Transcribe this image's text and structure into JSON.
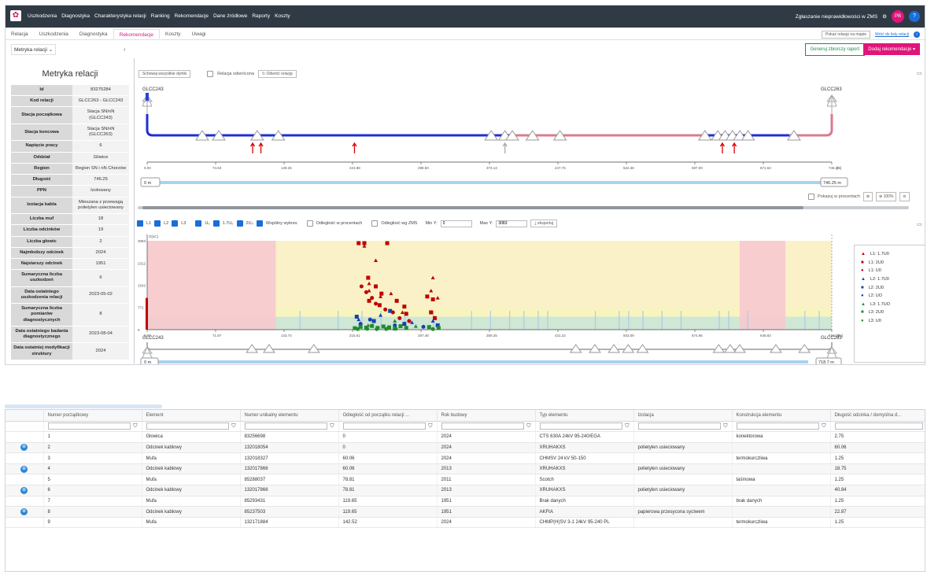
{
  "nav": {
    "items": [
      "Uszkodzenia",
      "Diagnostyka",
      "Charakterystyka relacji",
      "Ranking",
      "Rekomendacje",
      "Dane źródłowe",
      "Raporty",
      "Koszty"
    ],
    "report_link": "Zgłaszanie nieprawidłowości w ZMS",
    "avatar": "PB",
    "help": "?"
  },
  "tabs": {
    "items": [
      "Relacja",
      "Uszkodzenia",
      "Diagnostyka",
      "Rekomendacje",
      "Koszty",
      "Uwagi"
    ],
    "active": "Rekomendacje",
    "map_button": "Pokaż relację na mapie",
    "back_link": "Wróć do listy relacji"
  },
  "toolbar": {
    "dropdown": "Metryka relacji",
    "report_button": "Generuj zbiorczy raport",
    "add_button": "Dodaj rekomendacje"
  },
  "metryka": {
    "title": "Metryka relacji",
    "rows": [
      [
        "Id",
        "83275284"
      ],
      [
        "Kod relacji",
        "GLCC263 - GLCC243"
      ],
      [
        "Stacja początkowa",
        "Stacja SN/nN (GLCC243)"
      ],
      [
        "Stacja koncowa",
        "Stacja SN/nN (GLCC263)"
      ],
      [
        "Napięcie pracy",
        "6"
      ],
      [
        "Oddział",
        "Gliwice"
      ],
      [
        "Region",
        "Region SN i nN Chorzów"
      ],
      [
        "Długość",
        "746.25"
      ],
      [
        "PPN",
        "Izolowany"
      ],
      [
        "Izolacja kabla",
        "Mieszana z przewagą polietylen usieciowany"
      ],
      [
        "Liczba muf",
        "18"
      ],
      [
        "Liczba odcinków",
        "19"
      ],
      [
        "Liczba głowic",
        "2"
      ],
      [
        "Najmłodszy odcinek",
        "2024"
      ],
      [
        "Najstarszy odcinek",
        "1951"
      ],
      [
        "Sumaryczna liczba uszkodzeń",
        "6"
      ],
      [
        "Data ostatniego uszkodzenia relacji",
        "2023-05-02"
      ],
      [
        "Sumaryczna liczba pomiarów diagnostycznych",
        "8"
      ],
      [
        "Data ostatniego badania diagnostycznego",
        "2023-08-04"
      ],
      [
        "Data ostatniej modyfikacji struktury",
        "2024"
      ]
    ]
  },
  "top_controls": {
    "show_all": "Schowaj wszystkie dymki",
    "reversed": "Relacja odwrócona",
    "reverse_btn": "Odwróć relację"
  },
  "schema": {
    "start": "GLCC243",
    "end": "GLCC263",
    "ticks": [
      "0.00",
      "74.63",
      "149.25",
      "223.88",
      "298.50",
      "373.13",
      "447.75",
      "522.38",
      "597.00",
      "671.63",
      "746.25"
    ],
    "unit": "[m]",
    "bar_start": "0 m",
    "bar_end": "746.25 m",
    "percent_label": "Pokazuj w procentach",
    "zoom_reset": "100%"
  },
  "chart_controls": {
    "l1": "L1",
    "l2": "L2",
    "l3": "L3",
    "u0": "U₀",
    "u17": "1.7U₀",
    "u2": "2U₀",
    "common": "Wspólny wykres",
    "pct": "Odległość w procentach",
    "zms": "Odległość wg ZMS",
    "miny_label": "Min Y:",
    "miny": "0",
    "maxy_label": "Max Y:",
    "maxy": "3083",
    "export": "eksportuj"
  },
  "chart_data": {
    "type": "scatter",
    "ylabel": "G[uC]",
    "xlabel": "[m]",
    "yticks": [
      "3083",
      "2312",
      "1542",
      "771",
      "0"
    ],
    "xticks": [
      "0.00",
      "71.87",
      "143.74",
      "215.61",
      "287.48",
      "359.35",
      "431.22",
      "503.09",
      "574.96",
      "646.83",
      "718.70"
    ],
    "ylim": [
      0,
      3083
    ],
    "xlim": [
      0,
      718.7
    ],
    "series": [
      {
        "name": "L1: 1.7U0",
        "color": "#c00000",
        "marker": "triangle",
        "values": [
          [
            228,
            2900
          ],
          [
            240,
            2400
          ],
          [
            233,
            1600
          ],
          [
            233,
            1350
          ],
          [
            245,
            1150
          ],
          [
            256,
            1250
          ],
          [
            268,
            600
          ],
          [
            300,
            1800
          ],
          [
            298,
            1350
          ],
          [
            305,
            1100
          ]
        ]
      },
      {
        "name": "L1: 2U0",
        "color": "#c00000",
        "marker": "square",
        "values": [
          [
            222,
            3000
          ],
          [
            228,
            3000
          ],
          [
            252,
            3000
          ],
          [
            232,
            1800
          ],
          [
            240,
            1500
          ],
          [
            246,
            1250
          ],
          [
            233,
            1000
          ],
          [
            244,
            850
          ],
          [
            262,
            1000
          ],
          [
            270,
            800
          ],
          [
            272,
            550
          ],
          [
            294,
            1150
          ],
          [
            300,
            1050
          ],
          [
            298,
            600
          ],
          [
            302,
            400
          ]
        ]
      },
      {
        "name": "L1: U0",
        "color": "#c00000",
        "marker": "circle",
        "values": [
          [
            225,
            1500
          ],
          [
            230,
            1300
          ],
          [
            236,
            1100
          ],
          [
            240,
            900
          ],
          [
            250,
            700
          ],
          [
            258,
            600
          ],
          [
            265,
            400
          ],
          [
            275,
            300
          ]
        ]
      },
      {
        "name": "L2: 1.7U0",
        "color": "#1a3fb0",
        "marker": "triangle",
        "values": [
          [
            222,
            350
          ],
          [
            245,
            500
          ],
          [
            278,
            250
          ],
          [
            300,
            300
          ]
        ]
      },
      {
        "name": "L2: 2U0",
        "color": "#1a3fb0",
        "marker": "square",
        "values": [
          [
            220,
            450
          ],
          [
            238,
            300
          ],
          [
            255,
            650
          ],
          [
            270,
            200
          ],
          [
            305,
            150
          ]
        ]
      },
      {
        "name": "L2: UO",
        "color": "#1a3fb0",
        "marker": "circle",
        "values": [
          [
            224,
            200
          ],
          [
            234,
            350
          ],
          [
            260,
            150
          ],
          [
            290,
            100
          ]
        ]
      },
      {
        "name": "L3: 1.7UO",
        "color": "#1e8c2e",
        "marker": "triangle",
        "values": [
          [
            232,
            150
          ],
          [
            260,
            300
          ],
          [
            282,
            120
          ]
        ]
      },
      {
        "name": "L3: 2U0",
        "color": "#1e8c2e",
        "marker": "square",
        "values": [
          [
            218,
            50
          ],
          [
            224,
            100
          ],
          [
            230,
            70
          ],
          [
            236,
            130
          ],
          [
            242,
            60
          ],
          [
            248,
            110
          ],
          [
            254,
            80
          ],
          [
            260,
            40
          ],
          [
            266,
            120
          ],
          [
            272,
            60
          ],
          [
            296,
            90
          ],
          [
            306,
            60
          ]
        ]
      },
      {
        "name": "L3: U0",
        "color": "#1e8c2e",
        "marker": "circle",
        "values": [
          [
            221,
            20
          ],
          [
            231,
            30
          ],
          [
            241,
            20
          ],
          [
            251,
            25
          ],
          [
            261,
            30
          ],
          [
            300,
            20
          ]
        ]
      }
    ],
    "bar_start": "0 m",
    "bar_end": "718.7 m",
    "start": "GLCC243",
    "end": "GLCC263"
  },
  "table": {
    "columns": [
      "",
      "Numer porządkowy",
      "Element",
      "Numer unikalny elementu",
      "Odległość od początku relacji ...",
      "Rok budowy",
      "Typ elementu",
      "Izolacja",
      "Konstrukcja elementu",
      "Długość odcinka / domyślna d..."
    ],
    "rows": [
      {
        "globe": false,
        "cells": [
          "1",
          "Głowica",
          "83256698",
          "0",
          "2024",
          "CTS 630A 24kV 95-240/EGA",
          "",
          "konektorowa",
          "2.75"
        ]
      },
      {
        "globe": true,
        "cells": [
          "2",
          "Odcinek kablowy",
          "132018054",
          "0",
          "2024",
          "XRUHAKXS",
          "polietylen usieciowany",
          "",
          "60.06"
        ]
      },
      {
        "globe": false,
        "cells": [
          "3",
          "Mufa",
          "132018327",
          "60.06",
          "2024",
          "CHMSV 24 kV 50-150",
          "",
          "termokurczliwa",
          "1.25"
        ]
      },
      {
        "globe": true,
        "cells": [
          "4",
          "Odcinek kablowy",
          "132017866",
          "60.06",
          "2013",
          "XRUHAKXS",
          "polietylen usieciowany",
          "",
          "18.75"
        ]
      },
      {
        "globe": false,
        "cells": [
          "5",
          "Mufa",
          "85288037",
          "78.81",
          "2011",
          "Scotch",
          "",
          "taśmowa",
          "1.25"
        ]
      },
      {
        "globe": true,
        "cells": [
          "6",
          "Odcinek kablowy",
          "132017866",
          "78.81",
          "2013",
          "XRUHAKXS",
          "polietylen usieciowany",
          "",
          "40.84"
        ]
      },
      {
        "globe": false,
        "cells": [
          "7",
          "Mufa",
          "85293431",
          "119.65",
          "1951",
          "Brak danych",
          "",
          "brak danych",
          "1.25"
        ]
      },
      {
        "globe": true,
        "cells": [
          "8",
          "Odcinek kablowy",
          "85237503",
          "119.65",
          "1951",
          "AKFtA",
          "papierowa przesycona sycIwem",
          "",
          "22.87"
        ]
      },
      {
        "globe": false,
        "cells": [
          "9",
          "Mufa",
          "132171884",
          "142.52",
          "2024",
          "CHMP(H)SV 3-1 24kV 95-240 PL",
          "",
          "termokurczliwa",
          "1.25"
        ]
      }
    ]
  }
}
